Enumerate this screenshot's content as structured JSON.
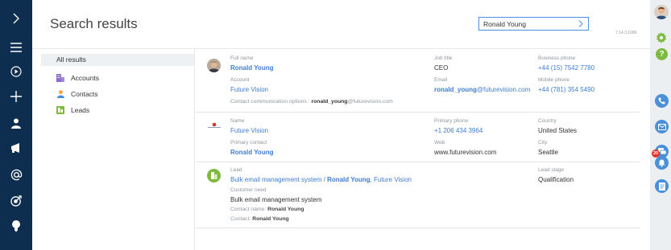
{
  "app": {
    "page_title": "Search results",
    "version": "7.14.3.1686",
    "brand_color": "#0d2e4e",
    "accent_color": "#3f7dd0"
  },
  "leftbar": {
    "items": [
      {
        "icon": "chevron-right-icon"
      },
      {
        "icon": "menu-icon"
      },
      {
        "icon": "play-circle-icon"
      },
      {
        "icon": "plus-icon"
      },
      {
        "icon": "user-icon"
      },
      {
        "icon": "megaphone-icon"
      },
      {
        "icon": "at-sign-icon"
      },
      {
        "icon": "target-icon"
      },
      {
        "icon": "lightbulb-icon"
      }
    ]
  },
  "search": {
    "value": "Ronald Young"
  },
  "filters": {
    "all": "All results",
    "items": [
      {
        "label": "Accounts",
        "icon": "accounts-icon"
      },
      {
        "label": "Contacts",
        "icon": "contacts-icon"
      },
      {
        "label": "Leads",
        "icon": "leads-icon"
      }
    ]
  },
  "results": {
    "contact": {
      "full_name_label": "Full name",
      "full_name": "Ronald Young",
      "account_label": "Account",
      "account": "Future Vision",
      "comm_label": "Contact communication options :",
      "comm_user": "ronald_young",
      "comm_domain": "@futurevision.com",
      "job_title_label": "Job title",
      "job_title": "CEO",
      "email_label": "Email",
      "email_user": "ronald_young",
      "email_domain": "@futurevision.com",
      "business_phone_label": "Business phone",
      "business_phone": "+44 (15) 7542 7780",
      "mobile_phone_label": "Mobile phone",
      "mobile_phone": "+44 (781) 354 5490"
    },
    "account": {
      "name_label": "Name",
      "name": "Future Vision",
      "primary_contact_label": "Primary contact",
      "primary_contact": "Ronald Young",
      "primary_phone_label": "Primary phone",
      "primary_phone": "+1 206 434 3964",
      "web_label": "Web",
      "web": "www.futurevision.com",
      "country_label": "Country",
      "country": "United States",
      "city_label": "City",
      "city": "Seattle"
    },
    "lead": {
      "lead_label": "Lead",
      "lead_part1": "Bulk email management system / ",
      "lead_part2": "Ronald Young",
      "lead_part3": ", Future Vision",
      "need_label": "Customer need",
      "need": "Bulk email management system",
      "contact_name_label": "Contact name:",
      "contact_name": "Ronald Young",
      "contact_label": "Contact:",
      "contact": "Ronald Young",
      "stage_label": "Lead stage",
      "stage": "Qualification"
    }
  },
  "rightbar": {
    "notifications_count": "20",
    "items": [
      {
        "icon": "profile-avatar-icon"
      },
      {
        "icon": "settings-gear-icon"
      },
      {
        "icon": "help-icon"
      },
      {
        "icon": "phone-icon"
      },
      {
        "icon": "email-icon"
      },
      {
        "icon": "chat-icon"
      },
      {
        "icon": "notifications-icon"
      },
      {
        "icon": "document-icon"
      }
    ]
  }
}
